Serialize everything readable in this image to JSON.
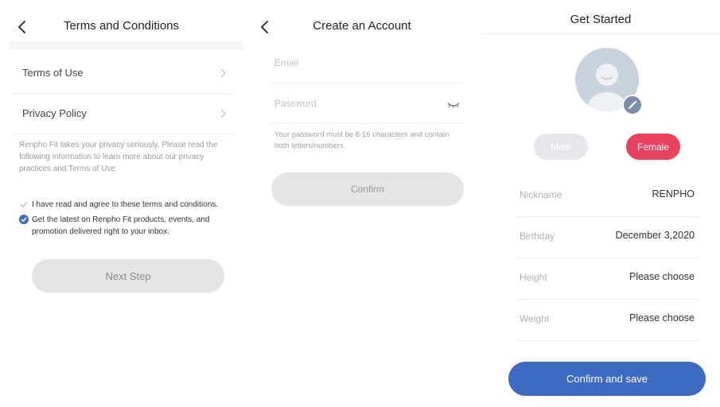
{
  "terms_screen": {
    "title": "Terms and Conditions",
    "links": [
      {
        "label": "Terms of Use"
      },
      {
        "label": "Privacy Policy"
      }
    ],
    "privacy_note": "Renpho Fit takes your privacy seriously. Please read the following information to learn more about our privacy practices and Terms of Use.",
    "agree_text": "I have read and agree to these terms and conditions.",
    "newsletter_text": "Get the latest on Renpho Fit products, events, and promotion delivered right to your inbox.",
    "next_label": "Next Step"
  },
  "account_screen": {
    "title": "Create an Account",
    "email_placeholder": "Email",
    "password_placeholder": "Password",
    "password_hint": "Your password must be 8-16 characters and contain both letters/numbers.",
    "confirm_label": "Confirm"
  },
  "profile_screen": {
    "title": "Get Started",
    "gender": {
      "male": "Male",
      "female": "Female",
      "selected": "Female"
    },
    "fields": [
      {
        "label": "Nickname",
        "value": "RENPHO"
      },
      {
        "label": "Birthday",
        "value": "December 3,2020"
      },
      {
        "label": "Height",
        "value": "Please choose"
      },
      {
        "label": "Weight",
        "value": "Please choose"
      }
    ],
    "save_label": "Confirm and save"
  },
  "colors": {
    "accent_blue": "#3d6bc2",
    "female_pink": "#e9425f",
    "disabled_button": "#e5e5e8"
  }
}
